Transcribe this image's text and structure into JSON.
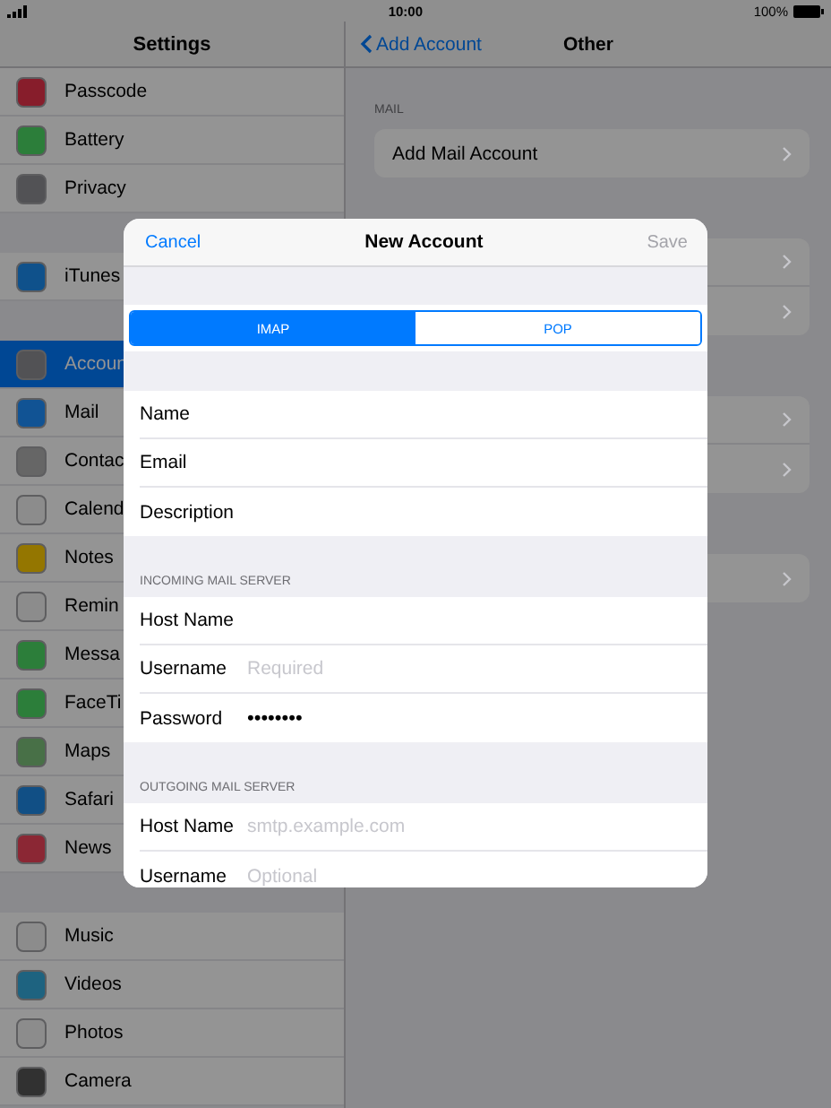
{
  "status_bar": {
    "time": "10:00",
    "battery": "100%"
  },
  "sidebar": {
    "title": "Settings",
    "groups": [
      {
        "items": [
          {
            "label": "Passcode",
            "color": "#871d2b",
            "selected": false
          },
          {
            "label": "Battery",
            "color": "#2c7e3a",
            "selected": false
          },
          {
            "label": "Privacy",
            "color": "#525255",
            "selected": false
          }
        ]
      },
      {
        "items": [
          {
            "label": "iTunes",
            "color": "#0f518b",
            "selected": false
          }
        ]
      },
      {
        "items": [
          {
            "label": "Accoun",
            "color": "#525255",
            "selected": true
          },
          {
            "label": "Mail",
            "color": "#115394",
            "selected": false
          },
          {
            "label": "Contac",
            "color": "#666666",
            "selected": false
          },
          {
            "label": "Calend",
            "color": "#8c8c8c",
            "selected": false
          },
          {
            "label": "Notes",
            "color": "#947600",
            "selected": false
          },
          {
            "label": "Remin",
            "color": "#8c8c8c",
            "selected": false
          },
          {
            "label": "Messa",
            "color": "#2c7e3a",
            "selected": false
          },
          {
            "label": "FaceTi",
            "color": "#2c7e3a",
            "selected": false
          },
          {
            "label": "Maps",
            "color": "#487047",
            "selected": false
          },
          {
            "label": "Safari",
            "color": "#114f85",
            "selected": false
          },
          {
            "label": "News",
            "color": "#8b2734",
            "selected": false
          }
        ]
      },
      {
        "items": [
          {
            "label": "Music",
            "color": "#8c8c8c",
            "selected": false
          },
          {
            "label": "Videos",
            "color": "#1e6380",
            "selected": false
          },
          {
            "label": "Photos",
            "color": "#8c8c8c",
            "selected": false
          },
          {
            "label": "Camera",
            "color": "#313131",
            "selected": false
          }
        ]
      }
    ]
  },
  "detail": {
    "back": "Add Account",
    "title": "Other",
    "section_header": "MAIL",
    "row": "Add Mail Account"
  },
  "modal": {
    "cancel": "Cancel",
    "title": "New Account",
    "save": {
      "label": "Save",
      "disabled": true
    },
    "segments": [
      {
        "label": "IMAP",
        "selected": true
      },
      {
        "label": "POP",
        "selected": false
      }
    ],
    "sections": [
      {
        "rows": [
          {
            "label": "Name"
          },
          {
            "label": "Email"
          },
          {
            "label": "Description"
          }
        ]
      },
      {
        "header": "INCOMING MAIL SERVER",
        "rows": [
          {
            "label": "Host Name"
          },
          {
            "label": "Username",
            "placeholder": "Required"
          },
          {
            "label": "Password",
            "value": "••••••••"
          }
        ]
      },
      {
        "header": "OUTGOING MAIL SERVER",
        "rows": [
          {
            "label": "Host Name",
            "placeholder": "smtp.example.com"
          },
          {
            "label": "Username",
            "placeholder": "Optional"
          }
        ]
      }
    ]
  }
}
